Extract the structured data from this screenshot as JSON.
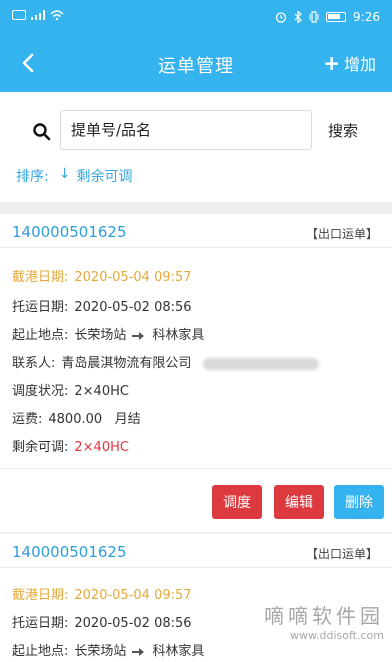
{
  "status_bar": {
    "time": "9:26"
  },
  "header": {
    "title": "运单管理",
    "add_label": "增加"
  },
  "search": {
    "placeholder": "提单号/品名",
    "button_label": "搜索"
  },
  "sort": {
    "label": "排序:",
    "arrow": "↓",
    "value": "剩余可调"
  },
  "waybills": [
    {
      "number": "140000501625",
      "type": "【出口运单】",
      "port_date_label": "截港日期:",
      "port_date": "2020-05-04 09:57",
      "ship_date_label": "托运日期:",
      "ship_date": "2020-05-02 08:56",
      "route_label": "起止地点:",
      "from": "长荣场站",
      "to": "科林家具",
      "contact_label": "联系人:",
      "contact": "青岛晨淇物流有限公司",
      "dispatch_label": "调度状况:",
      "dispatch": "2×40HC",
      "fee_label": "运费:",
      "fee": "4800.00",
      "fee_term": "月结",
      "remaining_label": "剩余可调:",
      "remaining": "2×40HC"
    },
    {
      "number": "140000501625",
      "type": "【出口运单】",
      "port_date_label": "截港日期:",
      "port_date": "2020-05-04 09:57",
      "ship_date_label": "托运日期:",
      "ship_date": "2020-05-02 08:56",
      "route_label": "起止地点:",
      "from": "长荣场站",
      "to": "科林家具"
    }
  ],
  "actions": {
    "dispatch": "调度",
    "edit": "编辑",
    "delete": "删除"
  },
  "colors": {
    "primary": "#35b3ee",
    "danger": "#dc3a3e",
    "port_date": "#e5a93b",
    "link": "#2e9edb"
  },
  "watermark": {
    "text": "嘀嘀软件园",
    "url": "www.ddisoft.com"
  }
}
